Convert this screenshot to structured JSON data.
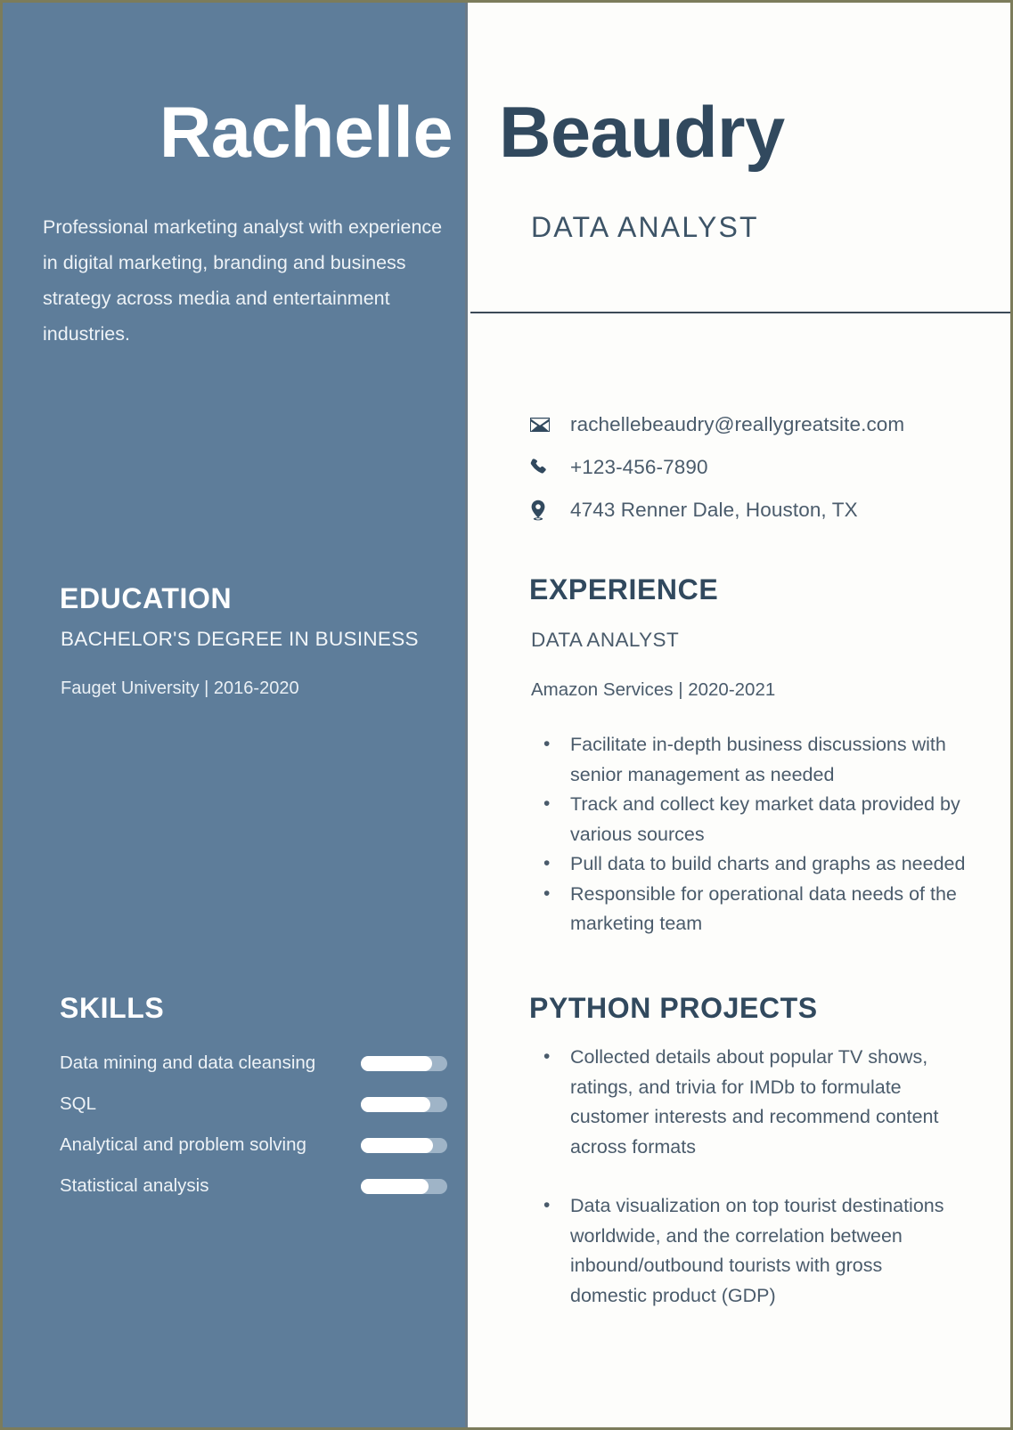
{
  "colors": {
    "sidebar_bg": "#5e7d9a",
    "page_bg": "#fdfdfb",
    "accent_navy": "#31495e",
    "body_text": "#4a5b6b",
    "page_border": "#7c7c5b",
    "bar_track": "#9fb4c7",
    "bar_fill": "#ffffff"
  },
  "header": {
    "first_name": "Rachelle",
    "last_name": "Beaudry",
    "job_title": "DATA ANALYST"
  },
  "sidebar": {
    "summary": "Professional marketing analyst with experience in digital marketing, branding and business strategy across media and entertainment industries.",
    "education": {
      "heading": "EDUCATION",
      "degree": "BACHELOR'S DEGREE IN BUSINESS",
      "school": "Fauget University | 2016-2020"
    },
    "skills": {
      "heading": "SKILLS",
      "items": [
        {
          "label": "Data mining and data cleansing",
          "level": 82
        },
        {
          "label": "SQL",
          "level": 80
        },
        {
          "label": "Analytical and problem solving",
          "level": 84
        },
        {
          "label": "Statistical analysis",
          "level": 78
        }
      ]
    }
  },
  "contact": {
    "email": "rachellebeaudry@reallygreatsite.com",
    "phone": "+123-456-7890",
    "address": "4743 Renner Dale, Houston, TX",
    "icons": {
      "email": "envelope-icon",
      "phone": "phone-icon",
      "address": "location-pin-icon"
    }
  },
  "experience": {
    "heading": "EXPERIENCE",
    "role": "DATA ANALYST",
    "company": "Amazon Services | 2020-2021",
    "bullets": [
      "Facilitate in-depth business discussions with senior management as needed",
      "Track and collect key market data provided by various sources",
      "Pull data to build charts and graphs as needed",
      "Responsible for operational data needs of the marketing team"
    ]
  },
  "projects": {
    "heading": "PYTHON PROJECTS",
    "bullets": [
      "Collected details about popular TV shows, ratings, and trivia for IMDb to formulate customer interests and recommend content across formats",
      "Data visualization on top tourist destinations worldwide, and the correlation between inbound/outbound tourists with gross domestic product (GDP)"
    ]
  }
}
